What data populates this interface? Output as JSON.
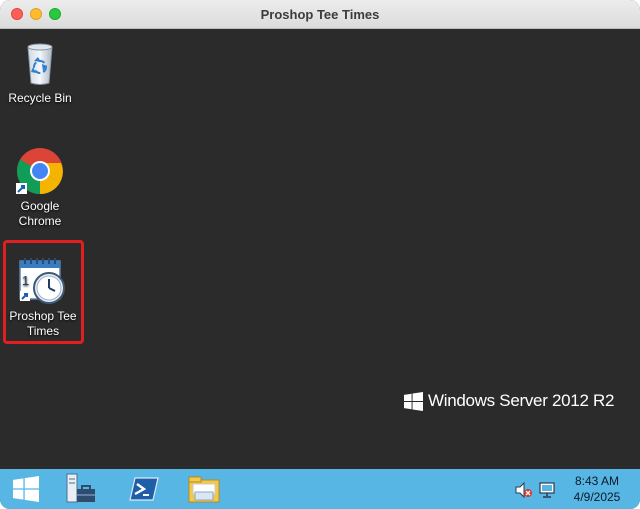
{
  "window": {
    "title": "Proshop Tee Times"
  },
  "desktop": {
    "icons": [
      {
        "label": "Recycle Bin",
        "icon": "recycle-bin-icon"
      },
      {
        "label": "Google Chrome",
        "icon": "chrome-icon"
      },
      {
        "label": "Proshop Tee Times",
        "icon": "calendar-clock-icon",
        "highlighted": true
      }
    ],
    "watermark": "Windows Server 2012 R2"
  },
  "taskbar": {
    "buttons": [
      "start-icon",
      "server-manager-icon",
      "powershell-icon",
      "file-explorer-icon"
    ],
    "tray": [
      "speaker-muted-icon",
      "network-icon"
    ],
    "clock": {
      "time": "8:43 AM",
      "date": "4/9/2025"
    }
  },
  "colors": {
    "desktop_bg": "#2b2b2b",
    "taskbar_bg": "#57b6e4",
    "highlight": "#e02020"
  }
}
